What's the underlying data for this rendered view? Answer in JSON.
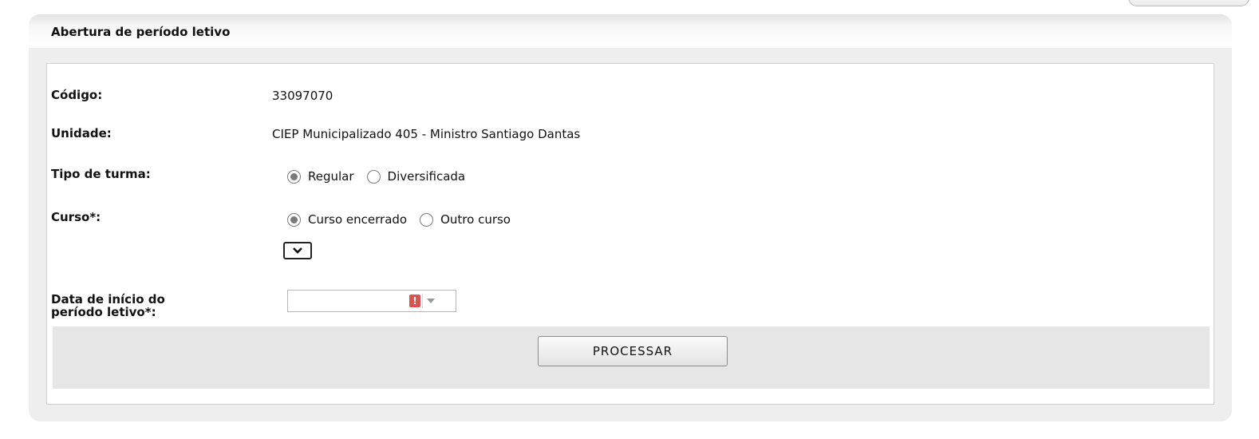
{
  "panel": {
    "title": "Abertura de período letivo"
  },
  "form": {
    "codigo": {
      "label": "Código:",
      "value": "33097070"
    },
    "unidade": {
      "label": "Unidade:",
      "value": "CIEP Municipalizado 405 - Ministro Santiago Dantas"
    },
    "tipo_turma": {
      "label": "Tipo de turma:",
      "options": [
        {
          "label": "Regular",
          "selected": true
        },
        {
          "label": "Diversificada",
          "selected": false
        }
      ]
    },
    "curso": {
      "label": "Curso*:",
      "options": [
        {
          "label": "Curso encerrado",
          "selected": true
        },
        {
          "label": "Outro curso",
          "selected": false
        }
      ],
      "select_value": ""
    },
    "data_inicio": {
      "label_line1": "Data de início do",
      "label_line2": "período letivo*:",
      "value": "",
      "error_icon": "!",
      "icons": [
        "error-icon",
        "dropdown-arrow-icon"
      ]
    }
  },
  "actions": {
    "process_label": "PROCESSAR"
  },
  "colors": {
    "panel_bg": "#eeeeee",
    "error": "#d9534f",
    "button_bar": "#e6e6e6"
  }
}
